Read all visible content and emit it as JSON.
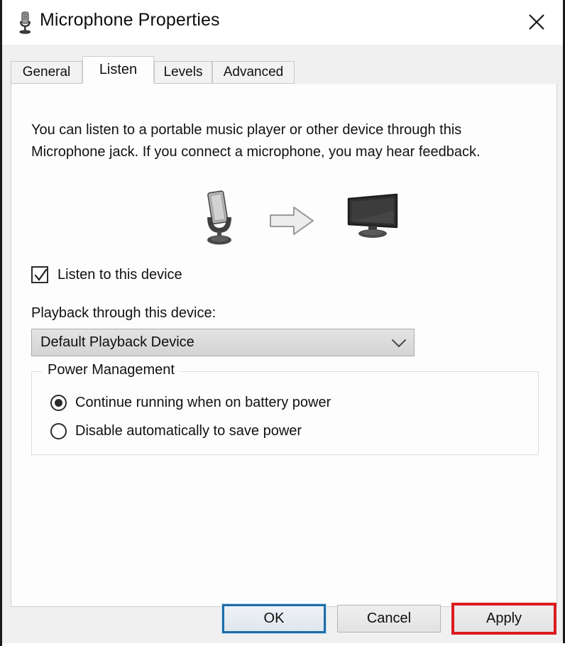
{
  "window": {
    "title": "Microphone Properties",
    "icon": "microphone-icon",
    "close_label": "×"
  },
  "tabs": [
    {
      "label": "General",
      "active": false
    },
    {
      "label": "Listen",
      "active": true
    },
    {
      "label": "Levels",
      "active": false
    },
    {
      "label": "Advanced",
      "active": false
    }
  ],
  "content": {
    "description": "You can listen to a portable music player or other device through this Microphone jack.  If you connect a microphone, you may hear feedback.",
    "illustration": {
      "source_icon": "microphone-device-icon",
      "flow_icon": "arrow-right-icon",
      "target_icon": "monitor-speaker-icon"
    },
    "listen_checkbox": {
      "label": "Listen to this device",
      "checked": true,
      "icon": "checkmark-icon"
    },
    "playback": {
      "label": "Playback through this device:",
      "selected": "Default Playback Device",
      "arrow_icon": "chevron-down-icon"
    },
    "power_management": {
      "title": "Power Management",
      "options": [
        {
          "label": "Continue running when on battery power",
          "selected": true
        },
        {
          "label": "Disable automatically to save power",
          "selected": false
        }
      ]
    }
  },
  "footer": {
    "ok": "OK",
    "cancel": "Cancel",
    "apply": "Apply"
  },
  "colors": {
    "focus_blue": "#1d6ea8",
    "highlight_red": "#dc1c20",
    "dialog_bg": "#f0f0f0",
    "panel_bg": "#fdfdfd"
  }
}
